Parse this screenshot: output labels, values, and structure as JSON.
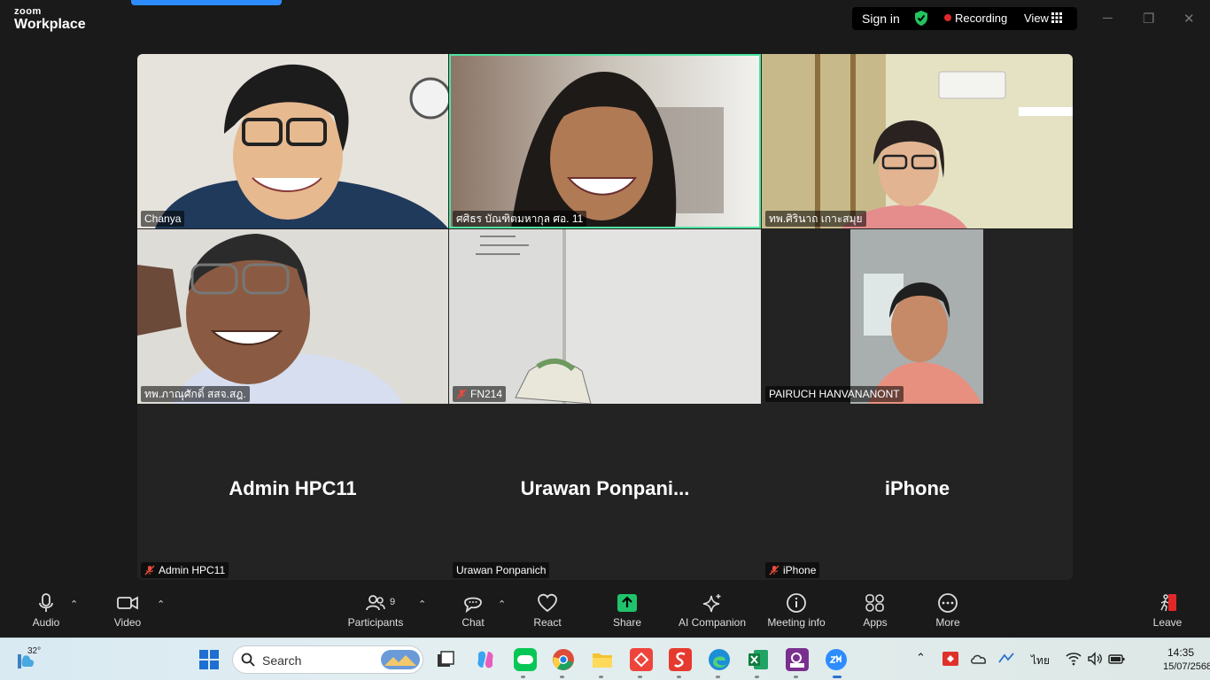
{
  "titlebar": {
    "brand_top": "zoom",
    "brand_main": "Workplace",
    "signin_label": "Sign in",
    "recording_label": "Recording",
    "view_label": "View"
  },
  "tiles": [
    {
      "name": "Chanya",
      "muted": false,
      "active": false
    },
    {
      "name": "ศศิธร บัณฑิตมหากุล ศอ. 11",
      "muted": false,
      "active": true
    },
    {
      "name": "ทพ.ศิรินาถ เกาะสมุย",
      "muted": false,
      "active": false
    },
    {
      "name": "ทพ.ภาณุศักดิ์ สสจ.สฎ.",
      "muted": false,
      "active": false
    },
    {
      "name": "FN214",
      "muted": true,
      "active": false
    },
    {
      "name": "PAIRUCH HANVANANONT",
      "muted": false,
      "active": false
    },
    {
      "name": "Admin HPC11",
      "display": "Admin HPC11",
      "muted": true,
      "active": false
    },
    {
      "name": "Urawan Ponpanich",
      "display": "Urawan  Ponpani...",
      "muted": false,
      "active": false
    },
    {
      "name": "iPhone",
      "display": "iPhone",
      "muted": true,
      "active": false
    }
  ],
  "toolbar": {
    "audio": "Audio",
    "video": "Video",
    "participants": "Participants",
    "participants_count": "9",
    "chat": "Chat",
    "react": "React",
    "share": "Share",
    "ai_companion": "AI Companion",
    "meeting_info": "Meeting info",
    "apps": "Apps",
    "more": "More",
    "leave": "Leave"
  },
  "taskbar": {
    "weather_temp": "32°",
    "search_placeholder": "Search",
    "language": "ไทย",
    "time": "14:35",
    "date": "15/07/2568"
  },
  "colors": {
    "active_speaker": "#4fe39f",
    "share_green": "#1fc36b",
    "recording_red": "#e02828",
    "brand_blue": "#2d8cff"
  }
}
